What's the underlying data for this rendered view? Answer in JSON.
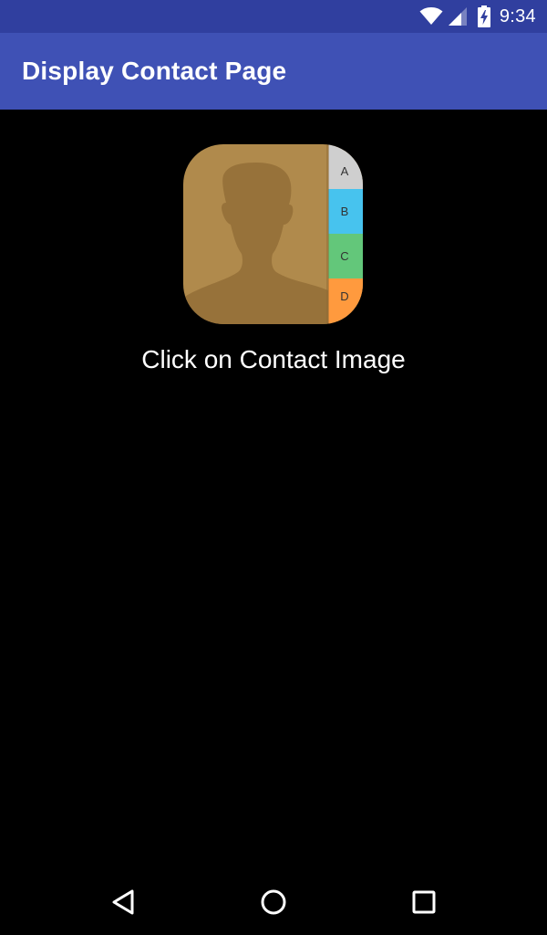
{
  "status_bar": {
    "time": "9:34",
    "icons": [
      "wifi-icon",
      "signal-icon",
      "battery-charging-icon"
    ]
  },
  "app_bar": {
    "title": "Display Contact Page",
    "color": "#3f51b5"
  },
  "contact_image": {
    "icon": "contacts-book-icon",
    "tabs": [
      "A",
      "B",
      "C",
      "D"
    ],
    "tab_colors": [
      "#cfcfcf",
      "#47c3ee",
      "#63c77a",
      "#ff9a3e"
    ],
    "background_color": "#b08a4c"
  },
  "caption": "Click on Contact Image",
  "nav_bar": {
    "buttons": [
      "back-icon",
      "home-icon",
      "recents-icon"
    ]
  }
}
